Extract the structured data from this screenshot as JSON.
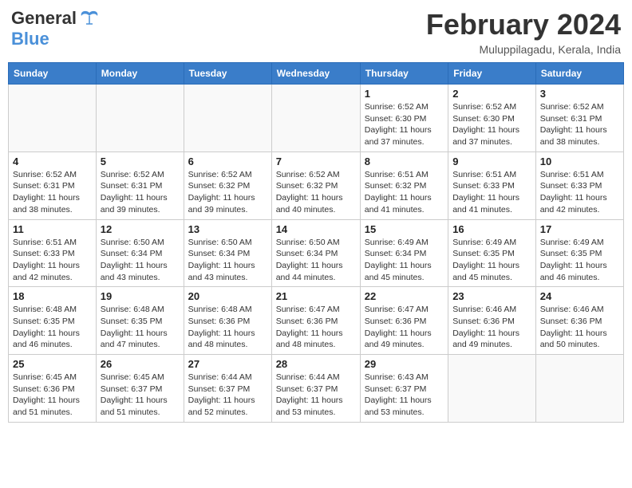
{
  "header": {
    "logo_general": "General",
    "logo_blue": "Blue",
    "month_title": "February 2024",
    "location": "Muluppilagadu, Kerala, India"
  },
  "days_of_week": [
    "Sunday",
    "Monday",
    "Tuesday",
    "Wednesday",
    "Thursday",
    "Friday",
    "Saturday"
  ],
  "weeks": [
    [
      {
        "day": "",
        "info": ""
      },
      {
        "day": "",
        "info": ""
      },
      {
        "day": "",
        "info": ""
      },
      {
        "day": "",
        "info": ""
      },
      {
        "day": "1",
        "info": "Sunrise: 6:52 AM\nSunset: 6:30 PM\nDaylight: 11 hours and 37 minutes."
      },
      {
        "day": "2",
        "info": "Sunrise: 6:52 AM\nSunset: 6:30 PM\nDaylight: 11 hours and 37 minutes."
      },
      {
        "day": "3",
        "info": "Sunrise: 6:52 AM\nSunset: 6:31 PM\nDaylight: 11 hours and 38 minutes."
      }
    ],
    [
      {
        "day": "4",
        "info": "Sunrise: 6:52 AM\nSunset: 6:31 PM\nDaylight: 11 hours and 38 minutes."
      },
      {
        "day": "5",
        "info": "Sunrise: 6:52 AM\nSunset: 6:31 PM\nDaylight: 11 hours and 39 minutes."
      },
      {
        "day": "6",
        "info": "Sunrise: 6:52 AM\nSunset: 6:32 PM\nDaylight: 11 hours and 39 minutes."
      },
      {
        "day": "7",
        "info": "Sunrise: 6:52 AM\nSunset: 6:32 PM\nDaylight: 11 hours and 40 minutes."
      },
      {
        "day": "8",
        "info": "Sunrise: 6:51 AM\nSunset: 6:32 PM\nDaylight: 11 hours and 41 minutes."
      },
      {
        "day": "9",
        "info": "Sunrise: 6:51 AM\nSunset: 6:33 PM\nDaylight: 11 hours and 41 minutes."
      },
      {
        "day": "10",
        "info": "Sunrise: 6:51 AM\nSunset: 6:33 PM\nDaylight: 11 hours and 42 minutes."
      }
    ],
    [
      {
        "day": "11",
        "info": "Sunrise: 6:51 AM\nSunset: 6:33 PM\nDaylight: 11 hours and 42 minutes."
      },
      {
        "day": "12",
        "info": "Sunrise: 6:50 AM\nSunset: 6:34 PM\nDaylight: 11 hours and 43 minutes."
      },
      {
        "day": "13",
        "info": "Sunrise: 6:50 AM\nSunset: 6:34 PM\nDaylight: 11 hours and 43 minutes."
      },
      {
        "day": "14",
        "info": "Sunrise: 6:50 AM\nSunset: 6:34 PM\nDaylight: 11 hours and 44 minutes."
      },
      {
        "day": "15",
        "info": "Sunrise: 6:49 AM\nSunset: 6:34 PM\nDaylight: 11 hours and 45 minutes."
      },
      {
        "day": "16",
        "info": "Sunrise: 6:49 AM\nSunset: 6:35 PM\nDaylight: 11 hours and 45 minutes."
      },
      {
        "day": "17",
        "info": "Sunrise: 6:49 AM\nSunset: 6:35 PM\nDaylight: 11 hours and 46 minutes."
      }
    ],
    [
      {
        "day": "18",
        "info": "Sunrise: 6:48 AM\nSunset: 6:35 PM\nDaylight: 11 hours and 46 minutes."
      },
      {
        "day": "19",
        "info": "Sunrise: 6:48 AM\nSunset: 6:35 PM\nDaylight: 11 hours and 47 minutes."
      },
      {
        "day": "20",
        "info": "Sunrise: 6:48 AM\nSunset: 6:36 PM\nDaylight: 11 hours and 48 minutes."
      },
      {
        "day": "21",
        "info": "Sunrise: 6:47 AM\nSunset: 6:36 PM\nDaylight: 11 hours and 48 minutes."
      },
      {
        "day": "22",
        "info": "Sunrise: 6:47 AM\nSunset: 6:36 PM\nDaylight: 11 hours and 49 minutes."
      },
      {
        "day": "23",
        "info": "Sunrise: 6:46 AM\nSunset: 6:36 PM\nDaylight: 11 hours and 49 minutes."
      },
      {
        "day": "24",
        "info": "Sunrise: 6:46 AM\nSunset: 6:36 PM\nDaylight: 11 hours and 50 minutes."
      }
    ],
    [
      {
        "day": "25",
        "info": "Sunrise: 6:45 AM\nSunset: 6:36 PM\nDaylight: 11 hours and 51 minutes."
      },
      {
        "day": "26",
        "info": "Sunrise: 6:45 AM\nSunset: 6:37 PM\nDaylight: 11 hours and 51 minutes."
      },
      {
        "day": "27",
        "info": "Sunrise: 6:44 AM\nSunset: 6:37 PM\nDaylight: 11 hours and 52 minutes."
      },
      {
        "day": "28",
        "info": "Sunrise: 6:44 AM\nSunset: 6:37 PM\nDaylight: 11 hours and 53 minutes."
      },
      {
        "day": "29",
        "info": "Sunrise: 6:43 AM\nSunset: 6:37 PM\nDaylight: 11 hours and 53 minutes."
      },
      {
        "day": "",
        "info": ""
      },
      {
        "day": "",
        "info": ""
      }
    ]
  ]
}
